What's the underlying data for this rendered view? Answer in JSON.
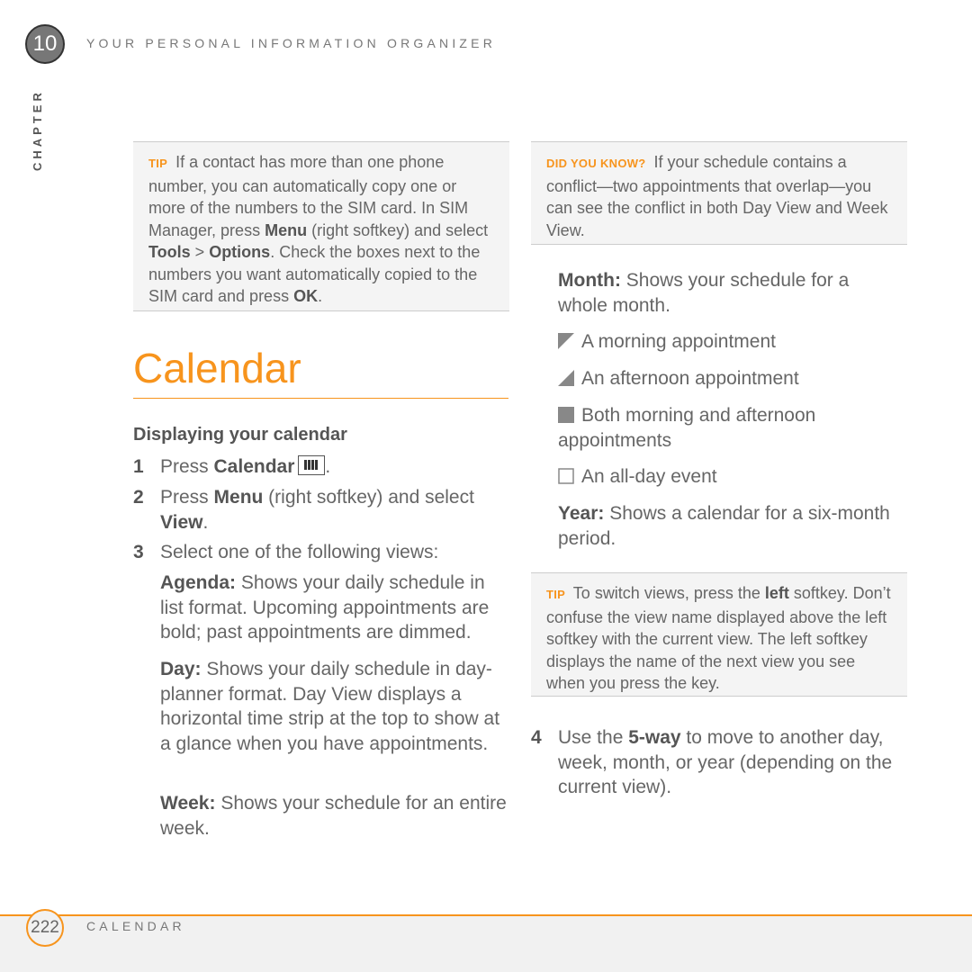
{
  "header": {
    "chapter_number": "10",
    "chapter_label": "CHAPTER",
    "section_title": "YOUR PERSONAL INFORMATION ORGANIZER"
  },
  "left": {
    "tip": {
      "label": "TIP",
      "s0": " If a contact has more than one phone number, you can automatically copy one or more of the numbers to the SIM card. In SIM Manager, press ",
      "b0": "Menu",
      "s1": " (right softkey) and select ",
      "b1": "Tools",
      "s2": " > ",
      "b2": "Options",
      "s3": ". Check the boxes next to the numbers you want automatically copied to the SIM card and press ",
      "b3": "OK",
      "s4": "."
    },
    "heading": "Calendar",
    "subheading": "Displaying your calendar",
    "steps": [
      {
        "n": "1",
        "s0": "Press ",
        "b0": "Calendar",
        "s1": "."
      },
      {
        "n": "2",
        "s0": "Press ",
        "b0": "Menu",
        "s1": " (right softkey) and select ",
        "b1": "View",
        "s2": "."
      },
      {
        "n": "3",
        "s0": "Select one of the following views:"
      }
    ],
    "views": [
      {
        "b": "Agenda:",
        "t": " Shows your daily schedule in list format. Upcoming appointments are bold; past appointments are dimmed."
      },
      {
        "b": "Day:",
        "t": " Shows your daily schedule in day-planner format. Day View displays a horizontal time strip at the top to show at a glance when you have appointments."
      },
      {
        "b": "Week:",
        "t": " Shows your schedule for an entire week."
      }
    ]
  },
  "right": {
    "didyouknow": {
      "label": "DID YOU KNOW?",
      "text": " If your schedule contains a conflict—two appointments that overlap—you can see the conflict in both Day View and Week View."
    },
    "month": {
      "b": "Month:",
      "t": " Shows your schedule for a whole month."
    },
    "legend": [
      {
        "icon": "morning-triangle-icon",
        "text": "A morning appointment"
      },
      {
        "icon": "afternoon-triangle-icon",
        "text": "An afternoon appointment"
      },
      {
        "icon": "filled-square-icon",
        "text": "Both morning and afternoon appointments"
      },
      {
        "icon": "empty-square-icon",
        "text": "An all-day event"
      }
    ],
    "year": {
      "b": "Year:",
      "t": " Shows a calendar for a six-month period."
    },
    "tip": {
      "label": "TIP",
      "s0": " To switch views, press the ",
      "b0": "left",
      "s1": " softkey. Don’t confuse the view name displayed above the left softkey with the current view. The left softkey displays the name of the next view you see when you press the key."
    },
    "step4": {
      "n": "4",
      "s0": "Use the ",
      "b0": "5-way",
      "s1": " to move to another day, week, month, or year (depending on the current view)."
    }
  },
  "footer": {
    "page_number": "222",
    "section": "CALENDAR"
  },
  "colors": {
    "accent": "#f7941d",
    "text": "#666666",
    "tip_bg": "#f4f4f4"
  }
}
